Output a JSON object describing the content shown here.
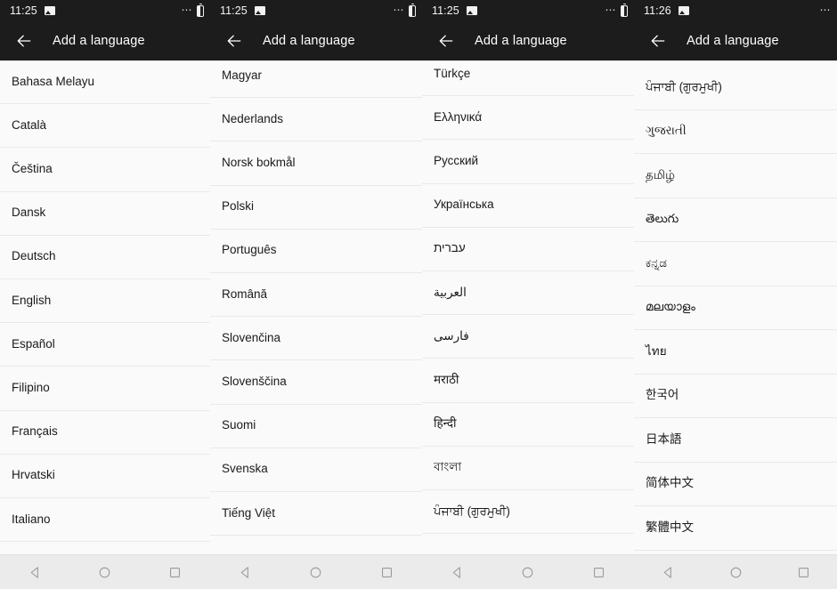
{
  "app": {
    "title": "Add a language",
    "back_icon": "arrow-left-icon",
    "statusbar_icons": {
      "photo": "photo-icon",
      "overflow": "more-dots-icon",
      "battery": "battery-icon"
    },
    "navbar": {
      "back": "back-triangle-icon",
      "home": "home-circle-icon",
      "recents": "recents-square-icon"
    },
    "colors": {
      "appbar_bg": "#1c1c1c",
      "statusbar_bg": "#1c1c1c",
      "list_bg": "#fafafa",
      "divider": "#e9e9e9",
      "navbar_bg": "#ebebeb",
      "text": "#1a1a1a",
      "appbar_text": "#ffffff"
    }
  },
  "panels": [
    {
      "id": "panel-1",
      "time": "11:25",
      "title": "Add a language",
      "languages": [
        "Bahasa Melayu",
        "Català",
        "Čeština",
        "Dansk",
        "Deutsch",
        "English",
        "Español",
        "Filipino",
        "Français",
        "Hrvatski",
        "Italiano"
      ]
    },
    {
      "id": "panel-2",
      "time": "11:25",
      "title": "Add a language",
      "languages": [
        "Magyar",
        "Nederlands",
        "Norsk bokmål",
        "Polski",
        "Português",
        "Română",
        "Slovenčina",
        "Slovenščina",
        "Suomi",
        "Svenska",
        "Tiếng Việt"
      ]
    },
    {
      "id": "panel-3",
      "time": "11:25",
      "title": "Add a language",
      "languages": [
        "Türkçe",
        "Ελληνικά",
        "Русский",
        "Українська",
        "עברית",
        "العربية",
        "فارسی",
        "मराठी",
        "हिन्दी",
        "বাংলা",
        "ਪੰਜਾਬੀ (ਗੁਰਮੁਖੀ)"
      ]
    },
    {
      "id": "panel-4",
      "time": "11:26",
      "title": "Add a language",
      "languages": [
        "ਪੰਜਾਬੀ (ਗੁਰਮੁਖੀ)",
        "ગુજરાતી",
        "தமிழ்",
        "తెలుగు",
        "ಕನ್ನಡ",
        "മലയാളം",
        "ไทย",
        "한국어",
        "日本語",
        "简体中文",
        "繁體中文"
      ]
    }
  ]
}
